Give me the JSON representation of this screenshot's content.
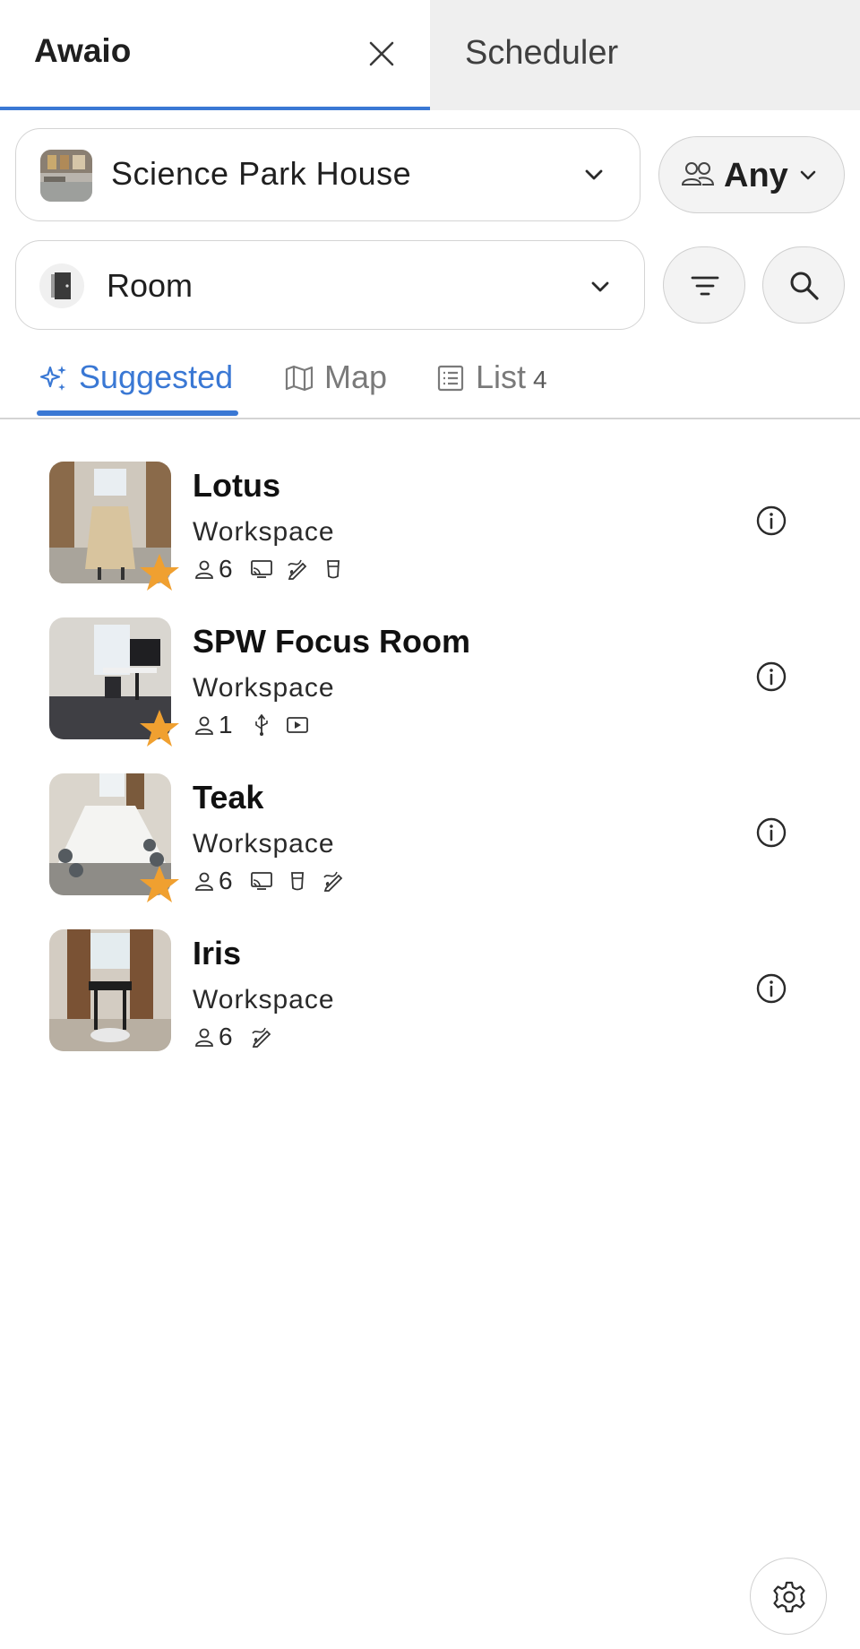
{
  "tabs": {
    "active": {
      "title": "Awaio"
    },
    "inactive": {
      "label": "Scheduler"
    }
  },
  "filters": {
    "building": {
      "value": "Science Park House",
      "icon": "building-photo"
    },
    "capacity": {
      "value": "Any",
      "icon": "people-icon"
    },
    "space_type": {
      "value": "Room",
      "icon": "door-icon"
    },
    "filter_button_icon": "filter-icon",
    "search_button_icon": "search-icon"
  },
  "view_tabs": [
    {
      "label": "Suggested",
      "icon": "sparkle-icon",
      "active": true
    },
    {
      "label": "Map",
      "icon": "map-icon",
      "active": false
    },
    {
      "label": "List",
      "icon": "list-icon",
      "active": false,
      "count": "4"
    }
  ],
  "rooms": [
    {
      "name": "Lotus",
      "type": "Workspace",
      "capacity": "6",
      "favorite": true,
      "features": [
        "cast-icon",
        "whiteboard-icon",
        "coffee-icon"
      ]
    },
    {
      "name": "SPW Focus Room",
      "type": "Workspace",
      "capacity": "1",
      "favorite": true,
      "features": [
        "usb-icon",
        "video-icon"
      ]
    },
    {
      "name": "Teak",
      "type": "Workspace",
      "capacity": "6",
      "favorite": true,
      "features": [
        "cast-icon",
        "coffee-icon",
        "whiteboard-icon"
      ]
    },
    {
      "name": "Iris",
      "type": "Workspace",
      "capacity": "6",
      "favorite": false,
      "features": [
        "whiteboard-icon"
      ]
    }
  ],
  "colors": {
    "accent": "#3a78d4",
    "star": "#f0a030",
    "inactive_tab_bg": "#efefef"
  }
}
